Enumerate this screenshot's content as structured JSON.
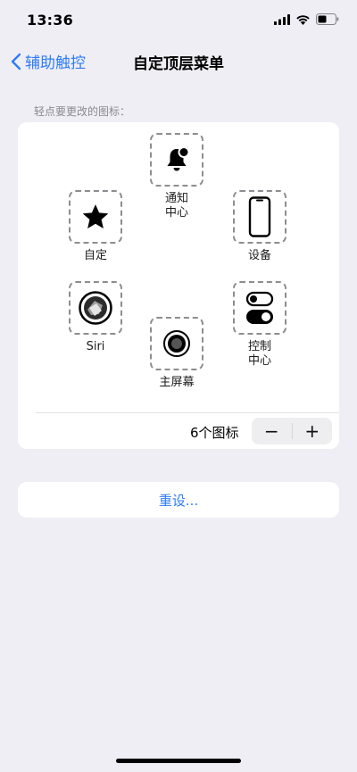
{
  "status_bar": {
    "time": "13:36"
  },
  "nav": {
    "back_label": "辅助触控",
    "title": "自定顶层菜单"
  },
  "section": {
    "label": "轻点要更改的图标："
  },
  "icons": {
    "notification": {
      "label_line1": "通知",
      "label_line2": "中心",
      "icon": "bell-icon"
    },
    "custom": {
      "label": "自定",
      "icon": "star-icon"
    },
    "device": {
      "label": "设备",
      "icon": "iphone-icon"
    },
    "siri": {
      "label": "Siri",
      "icon": "siri-icon"
    },
    "home": {
      "label": "主屏幕",
      "icon": "home-button-icon"
    },
    "control_center": {
      "label_line1": "控制",
      "label_line2": "中心",
      "icon": "toggle-switches-icon"
    }
  },
  "counter": {
    "label": "6个图标",
    "minus": "−",
    "plus": "+"
  },
  "reset": {
    "label": "重设..."
  },
  "colors": {
    "accent": "#2f7cf6",
    "background": "#efeef4",
    "card": "#ffffff"
  }
}
